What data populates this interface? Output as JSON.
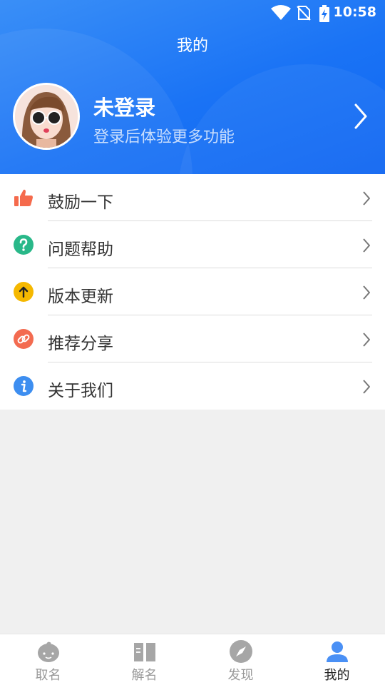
{
  "status_bar": {
    "time": "10:58"
  },
  "header": {
    "title": "我的"
  },
  "profile": {
    "name": "未登录",
    "subtitle": "登录后体验更多功能"
  },
  "menu": {
    "items": [
      {
        "label": "鼓励一下",
        "icon": "thumbs-up-icon",
        "color": "#f56a4c"
      },
      {
        "label": "问题帮助",
        "icon": "question-icon",
        "color": "#29b889"
      },
      {
        "label": "版本更新",
        "icon": "up-arrow-icon",
        "color": "#f5b800"
      },
      {
        "label": "推荐分享",
        "icon": "link-icon",
        "color": "#f36b50"
      },
      {
        "label": "关于我们",
        "icon": "info-icon",
        "color": "#3d8ef0"
      }
    ]
  },
  "tabs": [
    {
      "label": "取名",
      "icon": "baby-face-icon"
    },
    {
      "label": "解名",
      "icon": "book-icon"
    },
    {
      "label": "发现",
      "icon": "compass-icon"
    },
    {
      "label": "我的",
      "icon": "person-icon",
      "active": true
    }
  ],
  "colors": {
    "primary": "#1a73f5",
    "tab_inactive": "#9a9a9a",
    "tab_active": "#4a90f5"
  }
}
